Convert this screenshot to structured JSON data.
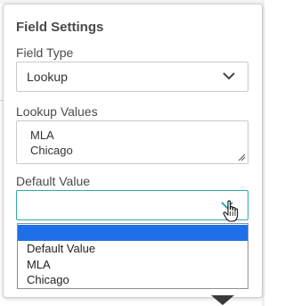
{
  "panel": {
    "title": "Field Settings"
  },
  "field_type": {
    "label": "Field Type",
    "selected": "Lookup",
    "icon": "chevron-down-icon"
  },
  "lookup_values": {
    "label": "Lookup Values",
    "lines": [
      "MLA",
      "Chicago"
    ],
    "icon": "resize-grip-icon"
  },
  "default_value": {
    "label": "Default Value",
    "selected": "",
    "icon": "chevron-down-icon",
    "accent_color": "#2fa8a8",
    "options": [
      "",
      "Default Value",
      "MLA",
      "Chicago"
    ],
    "highlight_color": "#1e6fe8"
  },
  "cursor": {
    "icon": "hand-pointer-icon"
  }
}
